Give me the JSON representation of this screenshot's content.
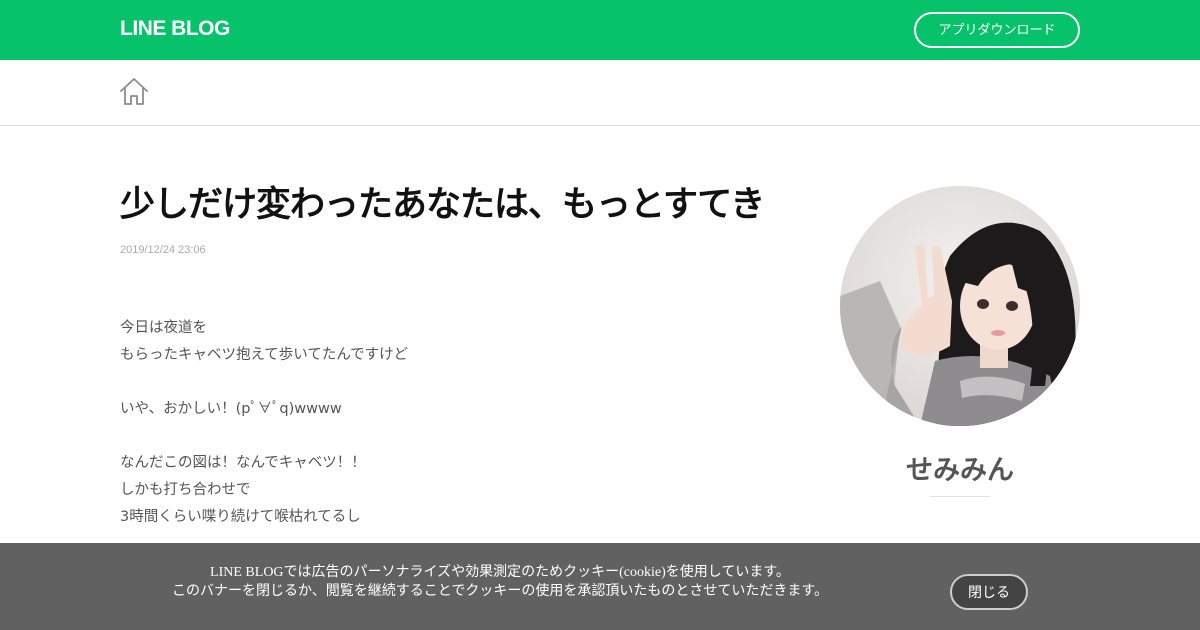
{
  "header": {
    "logo": "LINE BLOG",
    "app_download": "アプリダウンロード"
  },
  "nav": {
    "home_icon": "home-icon"
  },
  "article": {
    "title": "少しだけ変わったあなたは、もっとすてき",
    "date": "2019/12/24 23:06",
    "lines": [
      "今日は夜道を",
      "もらったキャベツ抱えて歩いてたんですけど",
      "",
      "いや、おかしい！(pﾟ∀ﾟq)wwww",
      "",
      "なんだこの図は！なんでキャベツ！！",
      "しかも打ち合わせで",
      "3時間くらい喋り続けて喉枯れてるし"
    ]
  },
  "sidebar": {
    "author_name": "せみみん"
  },
  "cookie_banner": {
    "line1": "LINE BLOGでは広告のパーソナライズや効果測定のためクッキー(cookie)を使用しています。",
    "line2": "このバナーを閉じるか、閲覧を継続することでクッキーの使用を承認頂いたものとさせていただきます。",
    "close_label": "閉じる"
  },
  "colors": {
    "brand_green": "#06c26a",
    "banner_bg": "#555555"
  }
}
